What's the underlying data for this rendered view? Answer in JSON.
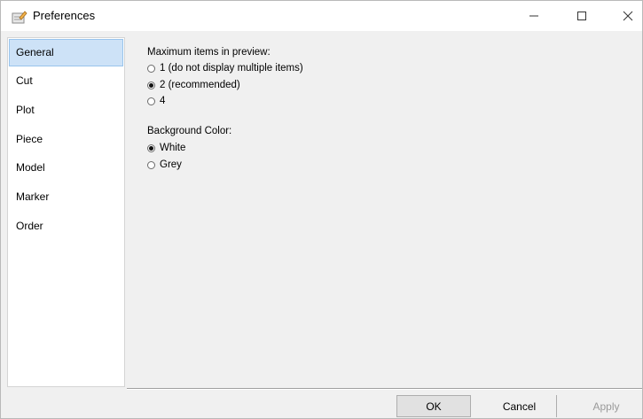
{
  "window": {
    "title": "Preferences"
  },
  "colors": {
    "selected_bg": "#cde2f7",
    "selected_border": "#99c4ec",
    "window_bg": "#f0f0f0"
  },
  "sidebar": {
    "items": [
      {
        "label": "General",
        "selected": true
      },
      {
        "label": "Cut"
      },
      {
        "label": "Plot"
      },
      {
        "label": "Piece"
      },
      {
        "label": "Model"
      },
      {
        "label": "Marker"
      },
      {
        "label": "Order"
      }
    ]
  },
  "preview": {
    "label": "Maximum items in preview:",
    "options": [
      {
        "label": "1 (do not display multiple items)",
        "checked": false
      },
      {
        "label": "2 (recommended)",
        "checked": true
      },
      {
        "label": "4",
        "checked": false
      }
    ]
  },
  "background": {
    "label": "Background Color:",
    "options": [
      {
        "label": "White",
        "checked": true
      },
      {
        "label": "Grey",
        "checked": false
      }
    ]
  },
  "buttons": {
    "ok": "OK",
    "cancel": "Cancel",
    "apply": "Apply"
  }
}
